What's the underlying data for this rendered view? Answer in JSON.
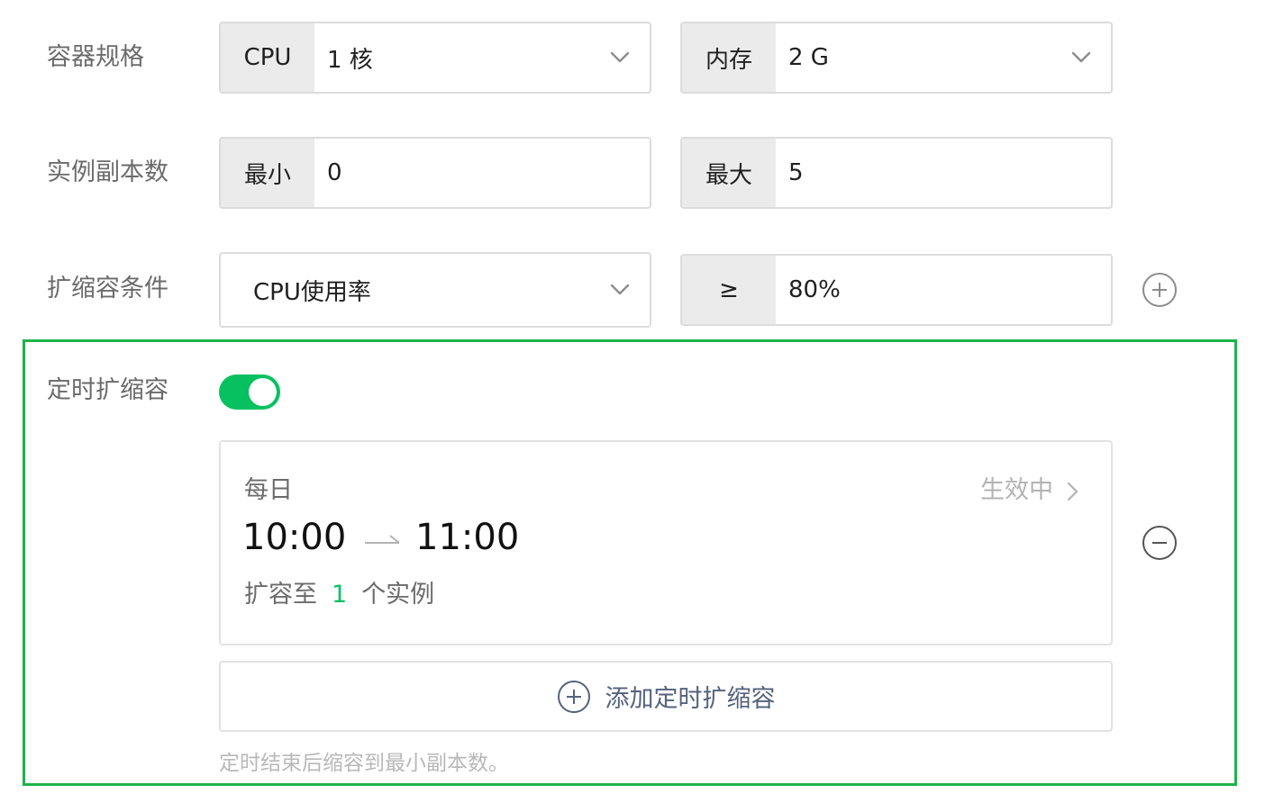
{
  "spec": {
    "label": "容器规格",
    "cpu": {
      "addon": "CPU",
      "value": "1 核"
    },
    "memory": {
      "addon": "内存",
      "value": "2 G"
    }
  },
  "replicas": {
    "label": "实例副本数",
    "min": {
      "addon": "最小",
      "value": "0"
    },
    "max": {
      "addon": "最大",
      "value": "5"
    }
  },
  "condition": {
    "label": "扩缩容条件",
    "metric": "CPU使用率",
    "operator": "≥",
    "threshold": "80%"
  },
  "scheduled": {
    "label": "定时扩缩容",
    "enabled": true,
    "rule": {
      "frequency": "每日",
      "status": "生效中",
      "start": "10:00",
      "end": "11:00",
      "scale_prefix": "扩容至",
      "instances": "1",
      "scale_suffix": "个实例"
    },
    "add_label": "添加定时扩缩容",
    "hint": "定时结束后缩容到最小副本数。"
  },
  "colors": {
    "accent_green": "#07c160",
    "highlight_border": "#1db34a",
    "icon_gray": "#8c8c8c",
    "add_text": "#55627c"
  },
  "icons": {
    "dropdown": "chevron-down-icon",
    "add_condition": "plus-circle-icon",
    "remove_rule": "minus-circle-icon",
    "status_arrow": "chevron-right-icon",
    "time_arrow": "arrow-right-icon",
    "add_schedule": "plus-circle-icon"
  }
}
